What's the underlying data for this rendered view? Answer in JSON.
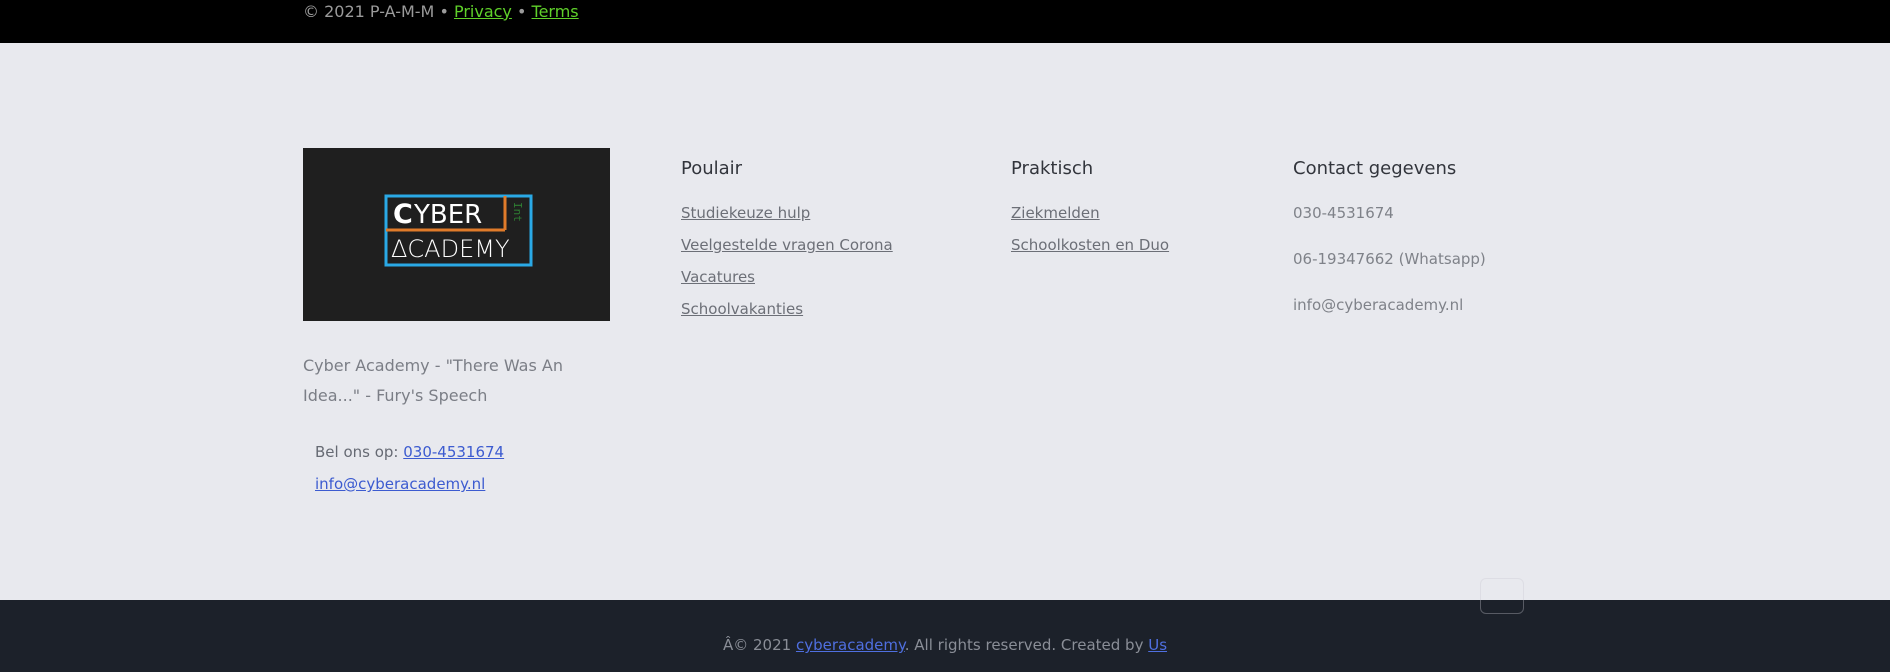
{
  "topbar": {
    "copyright": "© 2021 P-A-M-M",
    "sep1": " • ",
    "privacy": "Privacy",
    "sep2": " • ",
    "terms": "Terms"
  },
  "logo": {
    "line1_c": "C",
    "line1_rest": "YBER",
    "line1_side": "Int",
    "line2": "ΔCADEMY",
    "colors": {
      "blue": "#2aa9e6",
      "orange": "#e07b2a",
      "green": "#2e7d32",
      "white": "#ffffff"
    }
  },
  "about": {
    "tagline": "Cyber Academy - \"There Was An Idea...\" - Fury's Speech",
    "call_label": "Bel ons op: ",
    "call_phone": "030-4531674",
    "email": "info@cyberacademy.nl"
  },
  "columns": {
    "popular": {
      "title": "Poulair",
      "links": [
        "Studiekeuze hulp",
        "Veelgestelde vragen Corona",
        "Vacatures",
        "Schoolvakanties"
      ]
    },
    "practical": {
      "title": "Praktisch",
      "links": [
        "Ziekmelden",
        "Schoolkosten en Duo"
      ]
    },
    "contact": {
      "title": "Contact gegevens",
      "items": [
        "030-4531674",
        "06-19347662 (Whatsapp)",
        "info@cyberacademy.nl"
      ]
    }
  },
  "footer": {
    "prefix": "Â© 2021 ",
    "site_link": "cyberacademy",
    "middle": ". All rights reserved. Created by ",
    "creator_link": "Us"
  },
  "colors": {
    "accent_green": "#5fd12a",
    "link_blue": "#3c5bd0",
    "footer_bg": "#1c212a"
  }
}
